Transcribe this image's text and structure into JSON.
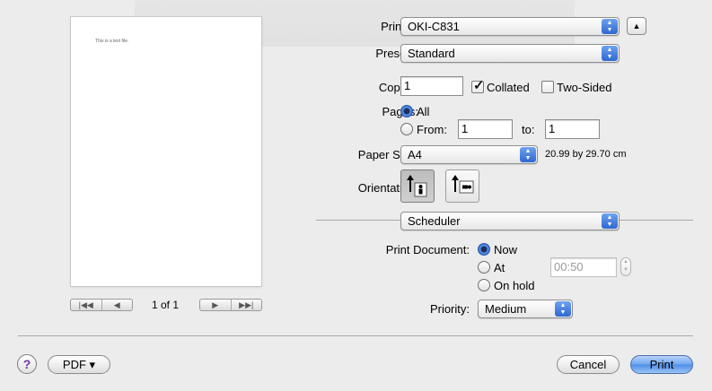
{
  "preview": {
    "page_text": "This is a test file.",
    "page_count": "1 of 1"
  },
  "printer": {
    "label": "Printer:",
    "value": "OKI-C831"
  },
  "presets": {
    "label": "Presets:",
    "value": "Standard"
  },
  "copies": {
    "label": "Copies:",
    "value": "1",
    "collated_label": "Collated",
    "collated": true,
    "two_sided_label": "Two-Sided",
    "two_sided": false
  },
  "pages": {
    "label": "Pages:",
    "all_label": "All",
    "from_label": "From:",
    "from_value": "1",
    "to_label": "to:",
    "to_value": "1",
    "selected": "All"
  },
  "paper_size": {
    "label": "Paper Size:",
    "value": "A4",
    "dimensions": "20.99 by 29.70 cm"
  },
  "orientation": {
    "label": "Orientation:",
    "selected": "portrait"
  },
  "section": {
    "value": "Scheduler"
  },
  "scheduler": {
    "print_document_label": "Print Document:",
    "now_label": "Now",
    "at_label": "At",
    "on_hold_label": "On hold",
    "selected": "Now",
    "time_value": "00:50",
    "priority_label": "Priority:",
    "priority_value": "Medium"
  },
  "footer": {
    "help_label": "?",
    "pdf_label": "PDF ▾",
    "cancel_label": "Cancel",
    "print_label": "Print"
  }
}
